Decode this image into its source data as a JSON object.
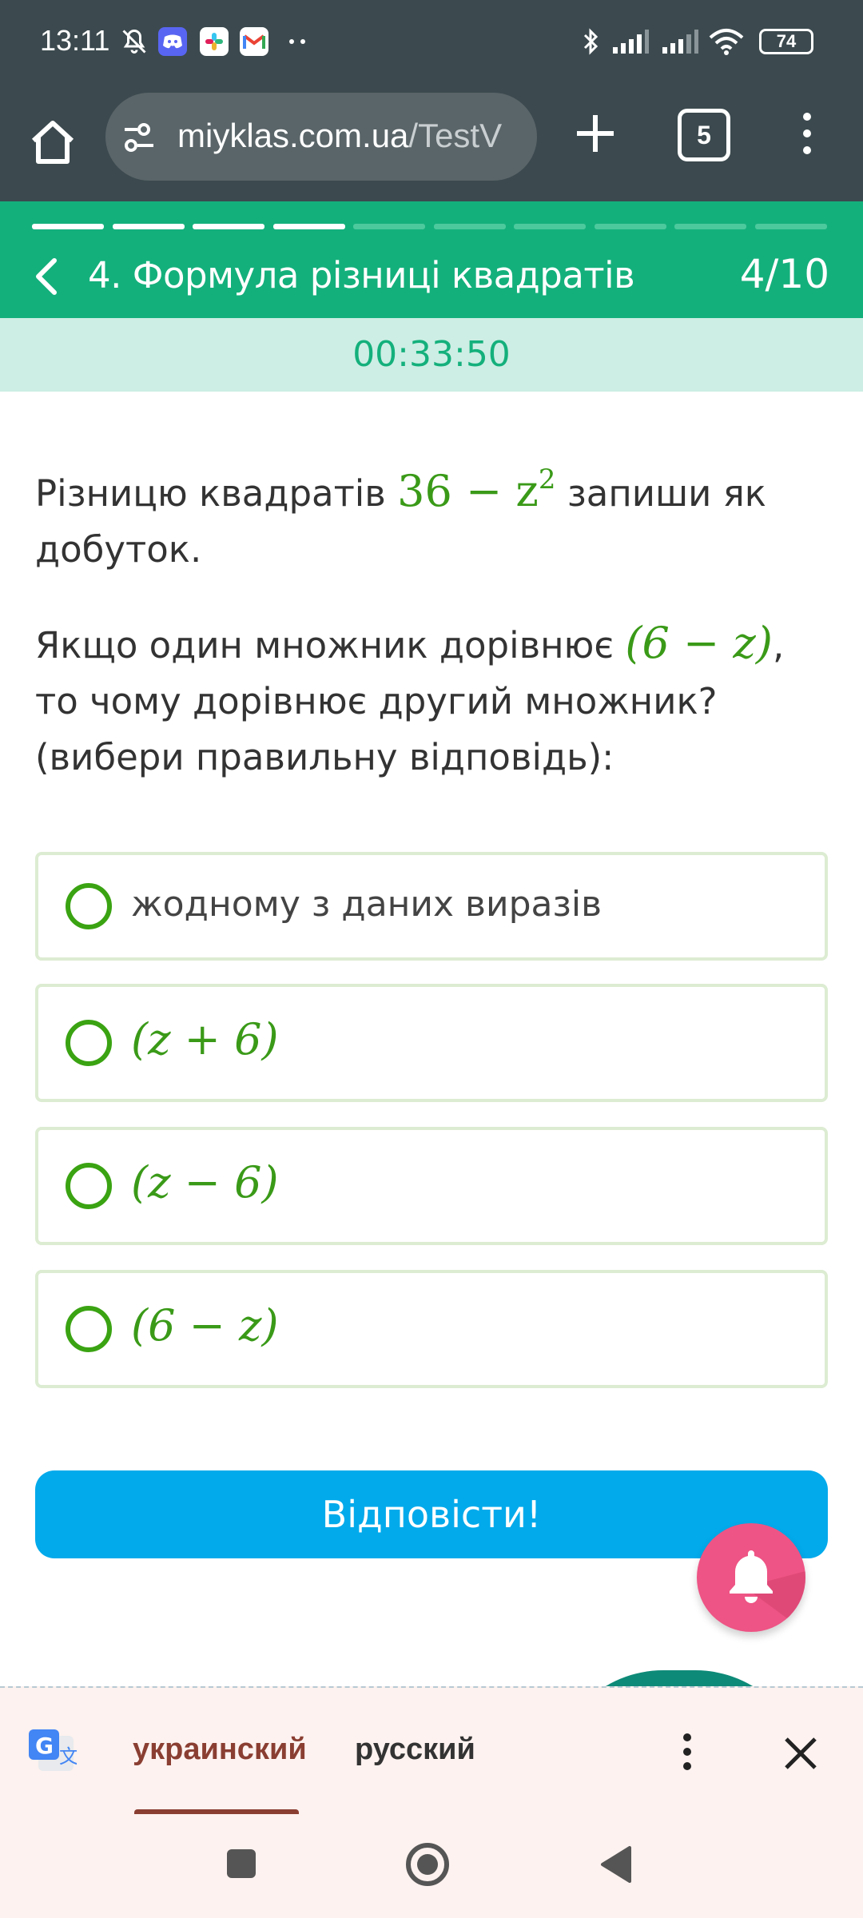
{
  "status_bar": {
    "time": "13:11",
    "battery": "74",
    "icons": [
      "bell-off-icon",
      "discord-icon",
      "slack-icon",
      "gmail-icon",
      "more-dots-icon",
      "bluetooth-icon",
      "signal-icon",
      "signal-icon",
      "wifi-icon",
      "battery-icon"
    ]
  },
  "browser": {
    "url_main": "miyklas.com.ua",
    "url_path": "/TestV",
    "tab_count": "5"
  },
  "quiz": {
    "title": "4. Формула різниці квадратів",
    "counter": "4/10",
    "progress_done": 4,
    "progress_total": 10,
    "timer": "00:33:50"
  },
  "question": {
    "part1_before": "Різницю квадратів ",
    "expr_base": "36 − z",
    "expr_exp": "2",
    "part1_after": " запиши як добуток.",
    "part2_before": "Якщо один множник дорівнює ",
    "factor": "(6 − z)",
    "part2_after": ", то чому дорівнює другий множник? (вибери правильну відповідь):"
  },
  "options": [
    {
      "label": "жодному з даних виразів",
      "is_math": false
    },
    {
      "label": "(z + 6)",
      "is_math": true
    },
    {
      "label": "(z − 6)",
      "is_math": true
    },
    {
      "label": "(6 − z)",
      "is_math": true
    }
  ],
  "answer_button": "Відповісти!",
  "translate_bar": {
    "lang_primary": "украинский",
    "lang_secondary": "русский"
  },
  "colors": {
    "header_green": "#14b07c",
    "math_green": "#3a9a18",
    "button_blue": "#02aaeb",
    "bell_pink": "#ee5485"
  }
}
